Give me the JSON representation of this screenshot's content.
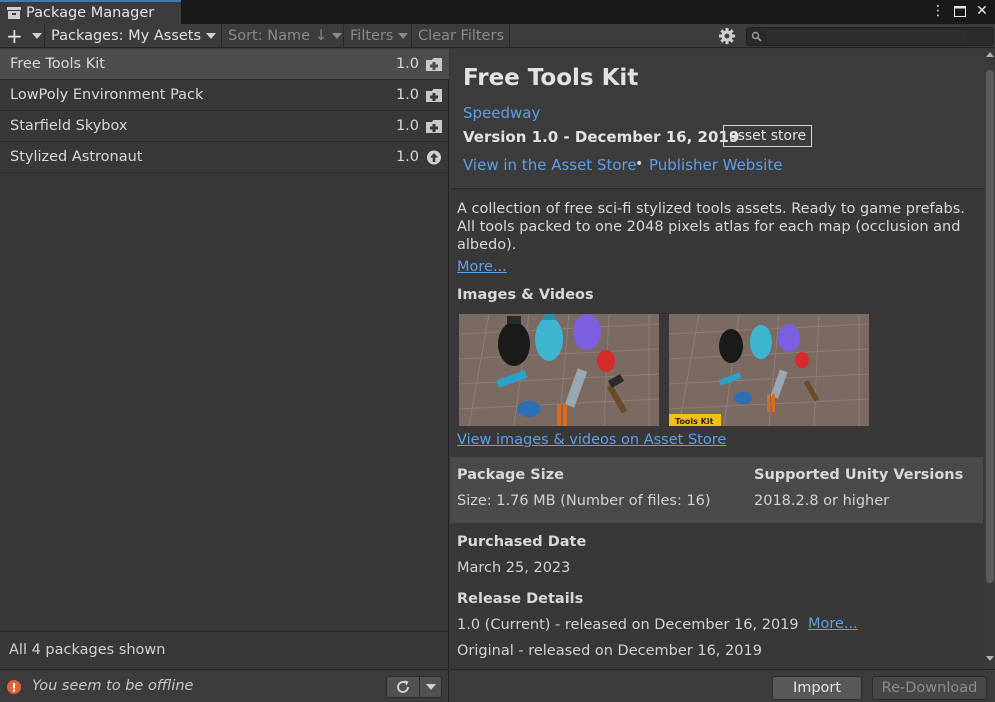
{
  "window": {
    "title": "Package Manager"
  },
  "toolbar": {
    "packages_label": "Packages: My Assets",
    "sort_label": "Sort: Name",
    "filters_label": "Filters",
    "clear_filters_label": "Clear Filters",
    "search_placeholder": ""
  },
  "packages": [
    {
      "name": "Free Tools Kit",
      "version": "1.0",
      "icon": "import-icon",
      "selected": true
    },
    {
      "name": "LowPoly Environment Pack",
      "version": "1.0",
      "icon": "import-icon",
      "selected": false
    },
    {
      "name": "Starfield Skybox",
      "version": "1.0",
      "icon": "import-icon",
      "selected": false
    },
    {
      "name": "Stylized Astronaut",
      "version": "1.0",
      "icon": "update-icon",
      "selected": false
    }
  ],
  "list_status": "All 4 packages shown",
  "offline_message": "You seem to be offline",
  "details": {
    "title": "Free Tools Kit",
    "author": "Speedway",
    "version_line": "Version 1.0 - December 16, 2019",
    "badge": "asset store",
    "link_store": "View in the Asset Store",
    "link_separator": "•",
    "link_publisher": "Publisher Website",
    "description": "A collection of free sci-fi stylized tools assets. Ready to game prefabs. All tools packed to one 2048 pixels atlas for each map (occlusion and albedo).",
    "more_label": "More...",
    "images_heading": "Images & Videos",
    "images_link": "View images & videos on Asset Store",
    "thumbnail_caption": "Tools Kit",
    "package_size_label": "Package Size",
    "package_size_value": "Size: 1.76 MB (Number of files: 16)",
    "unity_versions_label": "Supported Unity Versions",
    "unity_versions_value": "2018.2.8 or higher",
    "purchased_label": "Purchased Date",
    "purchased_value": "March 25, 2023",
    "release_label": "Release Details",
    "release_current": "1.0 (Current) - released on December 16, 2019",
    "release_more": "More...",
    "release_original": "Original - released on December 16, 2019"
  },
  "buttons": {
    "import": "Import",
    "redownload": "Re-Download"
  },
  "colors": {
    "accent_link": "#5f9ee8",
    "tab_highlight": "#3a79bb",
    "offline_warning": "#e0643a"
  }
}
